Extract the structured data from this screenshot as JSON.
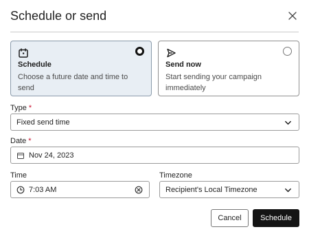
{
  "dialog": {
    "title": "Schedule or send",
    "close_icon": "close-icon"
  },
  "options": [
    {
      "title": "Schedule",
      "description": "Choose a future date and time to send",
      "selected": true,
      "icon": "calendar-icon"
    },
    {
      "title": "Send now",
      "description": "Start sending your campaign immediately",
      "selected": false,
      "icon": "send-icon"
    }
  ],
  "type_field": {
    "label": "Type",
    "required_mark": "*",
    "value": "Fixed send time"
  },
  "date_field": {
    "label": "Date",
    "required_mark": "*",
    "value": "Nov 24, 2023",
    "icon": "calendar-small-icon"
  },
  "time_field": {
    "label": "Time",
    "value": "7:03 AM",
    "icon": "clock-icon",
    "clear_icon": "clear-icon"
  },
  "timezone_field": {
    "label": "Timezone",
    "value": "Recipient's Local Timezone"
  },
  "actions": {
    "cancel_label": "Cancel",
    "schedule_label": "Schedule"
  },
  "colors": {
    "accent": "#141414",
    "required": "#c8102e",
    "selected_card_bg": "#e8eef4"
  }
}
